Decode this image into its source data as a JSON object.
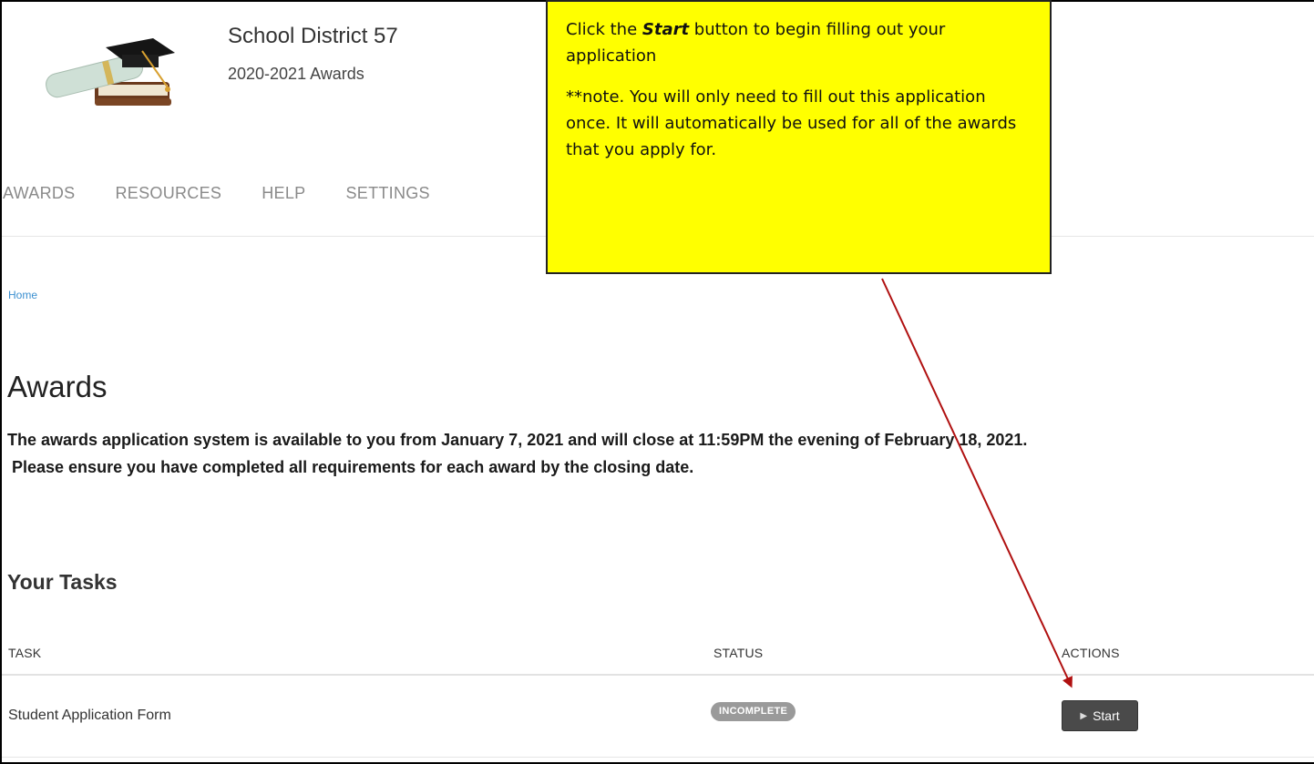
{
  "header": {
    "site_name": "School District 57",
    "site_sub": "2020-2021 Awards",
    "logo_icon": "graduation-cap-diploma-book-icon"
  },
  "nav": {
    "items": [
      "AWARDS",
      "RESOURCES",
      "HELP",
      "SETTINGS"
    ]
  },
  "breadcrumb": "Home",
  "page": {
    "title": "Awards",
    "notice_line1": "The awards application system is available to you from January 7, 2021 and will close at 11:59PM the evening of February 18, 2021.",
    "notice_line2": "Please ensure you have completed all requirements for each award by the closing date."
  },
  "tasks": {
    "title": "Your Tasks",
    "columns": [
      "TASK",
      "STATUS",
      "ACTIONS"
    ],
    "rows": [
      {
        "task": "Student Application Form",
        "status": "INCOMPLETE",
        "action": "Start"
      }
    ]
  },
  "callout": {
    "line1_prefix": "Click the ",
    "line1_emph": "Start",
    "line1_suffix": " button to begin filling out your application",
    "note": "**note. You will only need to fill out this application once. It will automatically be used for all of the awards that you apply for."
  },
  "colors": {
    "callout_bg": "#ffff00",
    "arrow": "#b01010",
    "badge": "#9a9a9a",
    "button": "#4a4a4a",
    "link": "#3a8fd0"
  }
}
